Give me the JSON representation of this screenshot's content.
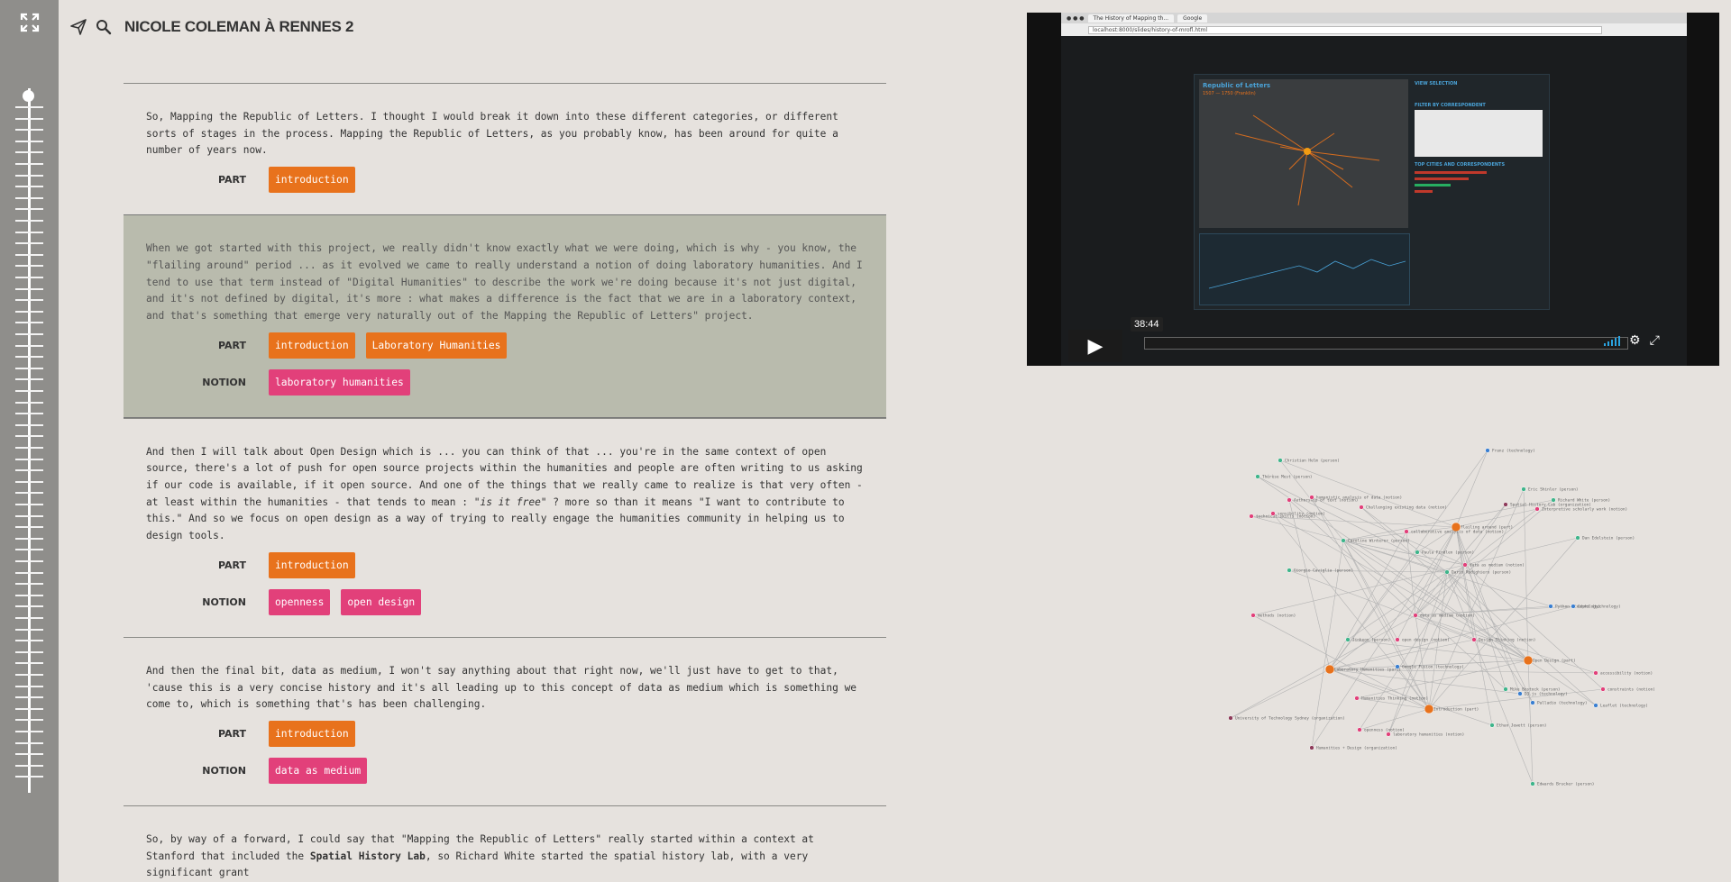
{
  "app": {
    "title": "NICOLE COLEMAN À RENNES 2"
  },
  "icons": {
    "expand": "expand-icon",
    "share": "paper-plane-icon",
    "search": "search-icon"
  },
  "segments": [
    {
      "text": "So, Mapping the Republic of Letters. I thought I would break it down into these different categories, or different sorts of stages in the process. Mapping the Republic of Letters, as you probably know, has been around for quite a number of years now.",
      "part_label": "PART",
      "parts": [
        "introduction"
      ],
      "notion_label": "",
      "notions": [],
      "active": false
    },
    {
      "text": "When we got started with this project, we really didn't know exactly what we were doing, which is why - you know, the \"flailing around\" period ... as it evolved we came to really understand a notion of doing laboratory humanities. And I tend to use that term instead of \"Digital Humanities\" to describe the work we're doing because it's not just digital, and it's not defined by digital, it's more : what makes a difference is the fact that we are in a laboratory context, and that's something that emerge very naturally out of the Mapping the Republic of Letters\" project.",
      "part_label": "PART",
      "parts": [
        "introduction",
        "Laboratory Humanities"
      ],
      "notion_label": "NOTION",
      "notions": [
        "laboratory humanities"
      ],
      "active": true
    },
    {
      "text_before": "And then I will talk about Open Design which is ... you can think of that ... you're in the same context of open source, there's a lot of push for open source projects within the humanities and people are often writing to us asking if our code is available, if it open source. And one of the things that we really came to realize is that very often - at least within the humanities - that tends to mean : ",
      "text_italic": "\"is it free\"",
      "text_after": " ? more so than it means \"I want to contribute to this.\" And so we focus on open design as a way of trying to really engage the humanities community in helping us to design tools.",
      "part_label": "PART",
      "parts": [
        "introduction"
      ],
      "notion_label": "NOTION",
      "notions": [
        "openness",
        "open design"
      ],
      "active": false
    },
    {
      "text": "And then the final bit, data as medium, I won't say anything about that right now, we'll just have to get to that, 'cause this is a very concise history and it's all leading up to this concept of data as medium which is something we come to, which is something that's has been challenging.",
      "part_label": "PART",
      "parts": [
        "introduction"
      ],
      "notion_label": "NOTION",
      "notions": [
        "data as medium"
      ],
      "active": false
    },
    {
      "text_before": "So, by way of a forward, I could say that \"Mapping the Republic of Letters\" really started within a context at Stanford that included the ",
      "text_bold": "Spatial History Lab",
      "text_after": ", so Richard White started the spatial history lab, with a very significant grant",
      "active": false
    }
  ],
  "video": {
    "time": "38:44",
    "progress": 0.0,
    "browser_tabs": [
      "The History of Mapping th...",
      "Google"
    ],
    "url": "localhost:8000/slides/history-of-mrofl.html",
    "app_title": "Republic of Letters",
    "app_subtitle": "1507 — 1750 (Franklin)",
    "panel_headers": [
      "VIEW SELECTION",
      "FILTER BY CORRESPONDENT",
      "TOP CITIES AND CORRESPONDENTS"
    ],
    "icons": [
      "play-icon",
      "volume-icon",
      "settings-icon",
      "fullscreen-icon"
    ]
  },
  "colors": {
    "part": "#e8721c",
    "notion": "#e2407a",
    "active_bg": "#b9bbad",
    "sidebar": "#8f8e8b",
    "background": "#e6e2de"
  },
  "graph": {
    "nodes": [
      {
        "label": "Franz (technology)",
        "type": "tech"
      },
      {
        "label": "Christian Helm (person)",
        "type": "person"
      },
      {
        "label": "Thérèse Mest (person)",
        "type": "person"
      },
      {
        "label": "Eric Shinler (person)",
        "type": "person"
      },
      {
        "label": "Richard White (person)",
        "type": "person"
      },
      {
        "label": "Authorship of text (notion)",
        "type": "notion"
      },
      {
        "label": "humanistic analysis of data (notion)",
        "type": "notion"
      },
      {
        "label": "Spatial History Lab (organization)",
        "type": "org"
      },
      {
        "label": "Interpretive scholarly work (notion)",
        "type": "notion"
      },
      {
        "label": "technical skills (notion)",
        "type": "notion"
      },
      {
        "label": "Challenging existing data (notion)",
        "type": "notion"
      },
      {
        "label": "sensibility (notion)",
        "type": "notion"
      },
      {
        "label": "flailing around (part)",
        "type": "part"
      },
      {
        "label": "collaborative analysis of data (notion)",
        "type": "notion"
      },
      {
        "label": "Dan Edelstein (person)",
        "type": "person"
      },
      {
        "label": "Caroline Winterer (person)",
        "type": "person"
      },
      {
        "label": "Paula Findlen (person)",
        "type": "person"
      },
      {
        "label": "data as medium (notion)",
        "type": "notion"
      },
      {
        "label": "Giorgio Caviglia (person)",
        "type": "person"
      },
      {
        "label": "Dario Rodighiero (person)",
        "type": "person"
      },
      {
        "label": "Python (technology)",
        "type": "tech"
      },
      {
        "label": "Gephi (technology)",
        "type": "tech"
      },
      {
        "label": "methods (notion)",
        "type": "notion"
      },
      {
        "label": "data as medium (notion)",
        "type": "notion"
      },
      {
        "label": "Design Thinking (notion)",
        "type": "notion"
      },
      {
        "label": "open design (notion)",
        "type": "notion"
      },
      {
        "label": "Jinkeon (person)",
        "type": "person"
      },
      {
        "label": "Laboratory Humanities (part)",
        "type": "part"
      },
      {
        "label": "Open Design (part)",
        "type": "part"
      },
      {
        "label": "accessibility (notion)",
        "type": "notion"
      },
      {
        "label": "constraints (notion)",
        "type": "notion"
      },
      {
        "label": "Palladio (technology)",
        "type": "tech"
      },
      {
        "label": "D3.js (technology)",
        "type": "tech"
      },
      {
        "label": "Mike Bostock (person)",
        "type": "person"
      },
      {
        "label": "Leaflet (technology)",
        "type": "tech"
      },
      {
        "label": "Humanities Thinking (notion)",
        "type": "notion"
      },
      {
        "label": "Introduction (part)",
        "type": "part"
      },
      {
        "label": "University of Technology Sydney (organization)",
        "type": "org"
      },
      {
        "label": "openness (notion)",
        "type": "notion"
      },
      {
        "label": "laboratory humanities (notion)",
        "type": "notion"
      },
      {
        "label": "Ethan Jewett (person)",
        "type": "person"
      },
      {
        "label": "Humanities + Design (organization)",
        "type": "org"
      },
      {
        "label": "Edwards Brucker (person)",
        "type": "person"
      },
      {
        "label": "Google Fusion (technology)",
        "type": "tech"
      }
    ]
  }
}
